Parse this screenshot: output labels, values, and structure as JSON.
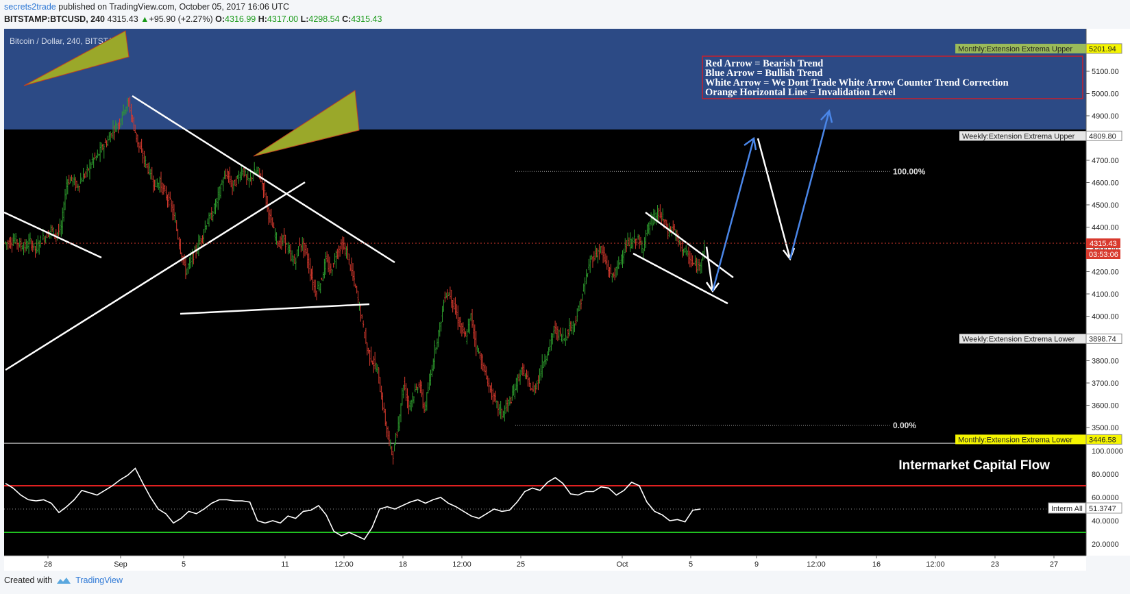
{
  "header": {
    "user": "secrets2trade",
    "published": " published on TradingView.com, October 05, 2017 16:06 UTC",
    "symbol": "BITSTAMP:BTCUSD, 240",
    "last": "4315.43",
    "change": "+95.90 (+2.27%)",
    "o_label": "O:",
    "o": "4316.99",
    "h_label": "H:",
    "h": "4317.00",
    "l_label": "L:",
    "l": "4298.54",
    "c_label": "C:",
    "c": "4315.43"
  },
  "footer": {
    "created": "Created with",
    "brand": "TradingView"
  },
  "colors": {
    "background": "#000000",
    "blueZone": "#2c4a85",
    "up": "#2e9e2e",
    "down": "#d83a2e",
    "arrowBlue": "#4a86e8",
    "annotBox": "#c8202c",
    "rsiRed": "#e02020",
    "rsiGreen": "#20c020"
  },
  "chart_data": [
    {
      "type": "candlestick",
      "title": "Bitcoin / Dollar, 240, BITSTAMP",
      "ylim": [
        3340,
        5300
      ],
      "y_ticks": [
        "5100.00",
        "5000.00",
        "4900.00",
        "4800.00",
        "4700.00",
        "4600.00",
        "4500.00",
        "4400.00",
        "4300.00",
        "4200.00",
        "4100.00",
        "4000.00",
        "3900.00",
        "3800.00",
        "3700.00",
        "3600.00",
        "3500.00"
      ],
      "x_ticks": [
        "28",
        "Sep",
        "5",
        "11",
        "12:00",
        "18",
        "12:00",
        "25",
        "Oct",
        "5",
        "9",
        "12:00",
        "16",
        "12:00",
        "23",
        "27"
      ],
      "bands": [
        {
          "label": "Monthly:Extension Extrema Upper",
          "value": "5201.94",
          "tag_color": "#f5f500"
        },
        {
          "label": "Weekly:Extension Extrema Upper",
          "value": "4809.80",
          "tag_color": "#ffffff"
        },
        {
          "label": "Weekly:Extension Extrema Lower",
          "value": "3898.74",
          "tag_color": "#ffffff"
        },
        {
          "label": "Monthly:Extension Extrema Lower",
          "value": "3446.58",
          "tag_color": "#f5f500"
        }
      ],
      "fib_levels": [
        {
          "label": "100.00%",
          "price": 4650
        },
        {
          "label": "0.00%",
          "price": 3510
        }
      ],
      "price_tag": "4315.43",
      "countdown": "03:53:06",
      "legend": [
        "Red Arrow = Bearish Trend",
        "Blue Arrow = Bullish Trend",
        "White Arrow = We Dont Trade White Arrow Counter Trend Correction",
        "Orange Horizontal Line = Invalidation Level"
      ],
      "closes": [
        4330,
        4345,
        4320,
        4310,
        4335,
        4300,
        4340,
        4360,
        4390,
        4370,
        4395,
        4600,
        4620,
        4580,
        4620,
        4650,
        4700,
        4720,
        4760,
        4790,
        4840,
        4860,
        4930,
        4960,
        4850,
        4760,
        4700,
        4650,
        4590,
        4600,
        4550,
        4510,
        4420,
        4300,
        4200,
        4250,
        4300,
        4350,
        4420,
        4450,
        4520,
        4600,
        4640,
        4580,
        4620,
        4660,
        4600,
        4640,
        4650,
        4580,
        4460,
        4380,
        4320,
        4350,
        4280,
        4240,
        4330,
        4300,
        4200,
        4110,
        4150,
        4250,
        4200,
        4280,
        4320,
        4290,
        4200,
        4100,
        3980,
        3850,
        3800,
        3750,
        3600,
        3450,
        3380,
        3520,
        3700,
        3600,
        3650,
        3700,
        3580,
        3700,
        3850,
        3950,
        4100,
        4100,
        4020,
        3950,
        3900,
        4000,
        3870,
        3800,
        3720,
        3650,
        3600,
        3560,
        3600,
        3640,
        3720,
        3760,
        3700,
        3660,
        3720,
        3800,
        3850,
        3940,
        3920,
        3900,
        3950,
        3970,
        4050,
        4150,
        4250,
        4280,
        4300,
        4240,
        4180,
        4200,
        4270,
        4320,
        4330,
        4350,
        4300,
        4390,
        4430,
        4460,
        4440,
        4380,
        4400,
        4330,
        4300,
        4260,
        4230,
        4220,
        4320
      ]
    },
    {
      "type": "line",
      "title": "Intermarket Capital Flow",
      "ylim": [
        10,
        105
      ],
      "y_ticks": [
        "100.0000",
        "80.0000",
        "60.0000",
        "40.0000",
        "20.0000"
      ],
      "levels": [
        70,
        30
      ],
      "series": [
        {
          "name": "Interm All",
          "last": "51.3747",
          "values": [
            72,
            68,
            62,
            58,
            57,
            58,
            55,
            47,
            52,
            58,
            66,
            64,
            62,
            66,
            70,
            75,
            79,
            85,
            72,
            60,
            50,
            46,
            38,
            42,
            48,
            46,
            50,
            55,
            58,
            58,
            57,
            57,
            56,
            40,
            38,
            40,
            38,
            44,
            42,
            48,
            49,
            53,
            45,
            31,
            27,
            30,
            27,
            24,
            34,
            50,
            52,
            50,
            53,
            56,
            58,
            55,
            58,
            60,
            55,
            52,
            48,
            44,
            42,
            46,
            50,
            48,
            49,
            56,
            65,
            68,
            66,
            73,
            77,
            72,
            63,
            62,
            65,
            65,
            69,
            68,
            62,
            66,
            73,
            70,
            56,
            48,
            45,
            40,
            41,
            39,
            49,
            50
          ]
        }
      ]
    }
  ]
}
